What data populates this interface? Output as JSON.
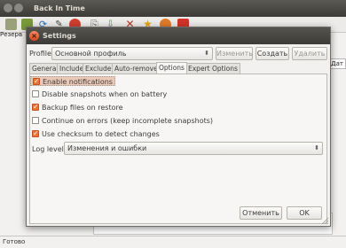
{
  "app": {
    "title": "Back In Time",
    "left_label": "Резерв",
    "right_tab": "Дат",
    "status": "Готово"
  },
  "dialog": {
    "title": "Settings",
    "profile_label": "Profile:",
    "profile_value": "Основной профиль",
    "btn_edit": "Изменить",
    "btn_create": "Создать",
    "btn_delete": "Удалить",
    "tabs": [
      "General",
      "Include",
      "Exclude",
      "Auto-remove",
      "Options",
      "Expert Options"
    ],
    "active_tab": "Options",
    "options": [
      {
        "label": "Enable notifications",
        "checked": true
      },
      {
        "label": "Disable snapshots when on battery",
        "checked": false
      },
      {
        "label": "Backup files on restore",
        "checked": true
      },
      {
        "label": "Continue on errors (keep incomplete snapshots)",
        "checked": false
      },
      {
        "label": "Use checksum to detect changes",
        "checked": true
      }
    ],
    "loglevel_label": "Log level:",
    "loglevel_value": "Изменения и ошибки",
    "btn_cancel": "Отменить",
    "btn_ok": "OK"
  },
  "colors": {
    "accent": "#f2713a",
    "titlebar": "#3c3b37"
  }
}
